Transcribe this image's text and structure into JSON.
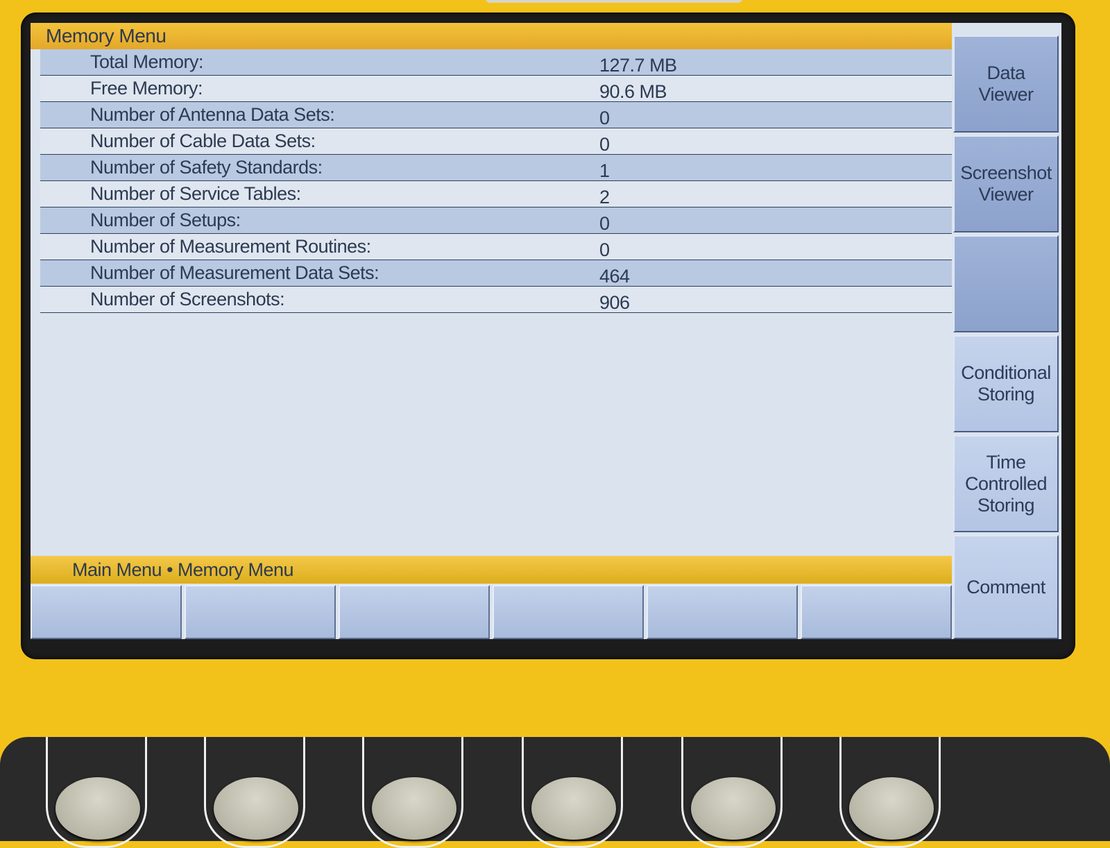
{
  "title_bar": {
    "title": "Memory Menu"
  },
  "memory_info": [
    {
      "label": "Total Memory:",
      "value": "127.7 MB"
    },
    {
      "label": "Free Memory:",
      "value": "90.6 MB"
    },
    {
      "label": "Number of Antenna Data Sets:",
      "value": "0"
    },
    {
      "label": "Number of Cable Data Sets:",
      "value": "0"
    },
    {
      "label": "Number of Safety Standards:",
      "value": "1"
    },
    {
      "label": "Number of Service Tables:",
      "value": "2"
    },
    {
      "label": "Number of Setups:",
      "value": "0"
    },
    {
      "label": "Number of Measurement Routines:",
      "value": "0"
    },
    {
      "label": "Number of Measurement Data Sets:",
      "value": "464"
    },
    {
      "label": "Number of Screenshots:",
      "value": "906"
    }
  ],
  "breadcrumb": {
    "text": "Main Menu • Memory Menu"
  },
  "side_buttons": [
    {
      "label": "Data\nViewer"
    },
    {
      "label": "Screenshot\nViewer"
    },
    {
      "label": ""
    },
    {
      "label": "Conditional\nStoring"
    },
    {
      "label": "Time\nControlled\nStoring"
    },
    {
      "label": "Comment"
    }
  ],
  "colors": {
    "device_body": "#f2c21a",
    "title_bar": "#e3a829",
    "row_odd": "#b9c9e2",
    "row_even": "#dfe6ef",
    "side_button": "#8ca2cc"
  }
}
